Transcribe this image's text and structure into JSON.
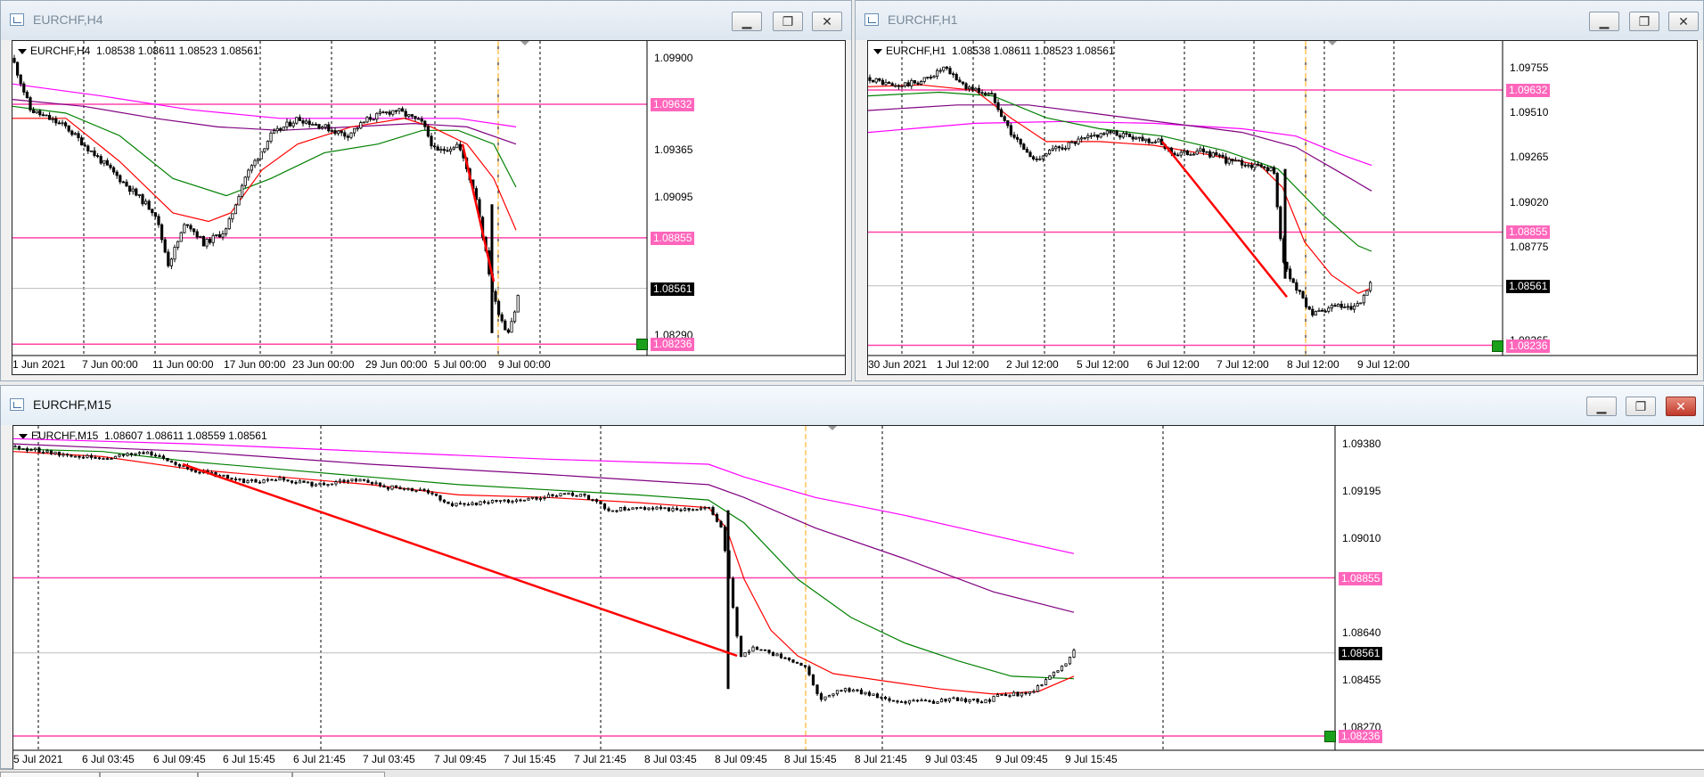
{
  "windows": [
    {
      "title": "EURCHF,H4",
      "info": "EURCHF,H4  1.08538 1.08611 1.08523 1.08561",
      "buttons": {
        "min": "▁",
        "max": "❐",
        "close": "✕"
      },
      "price_ticks": [
        "1.09900",
        "1.09365",
        "1.09095",
        "1.08290"
      ],
      "hline_labels": [
        "1.09632",
        "1.08855",
        "1.08236"
      ],
      "current_price": "1.08561",
      "time_labels": [
        "1 Jun 2021",
        "7 Jun 00:00",
        "11 Jun 00:00",
        "17 Jun 00:00",
        "23 Jun 00:00",
        "29 Jun 00:00",
        "5 Jul 00:00",
        "9 Jul 00:00"
      ]
    },
    {
      "title": "EURCHF,H1",
      "info": "EURCHF,H1  1.08538 1.08611 1.08523 1.08561",
      "buttons": {
        "min": "▁",
        "max": "❐",
        "close": "✕"
      },
      "price_ticks": [
        "1.09755",
        "1.09510",
        "1.09265",
        "1.09020",
        "1.08775",
        "1.08265"
      ],
      "hline_labels": [
        "1.09632",
        "1.08855",
        "1.08236"
      ],
      "current_price": "1.08561",
      "time_labels": [
        "30 Jun 2021",
        "1 Jul 12:00",
        "2 Jul 12:00",
        "5 Jul 12:00",
        "6 Jul 12:00",
        "7 Jul 12:00",
        "8 Jul 12:00",
        "9 Jul 12:00"
      ]
    },
    {
      "title": "EURCHF,M15",
      "info": "EURCHF,M15  1.08607 1.08611 1.08559 1.08561",
      "buttons": {
        "min": "▁",
        "max": "❐",
        "close": "✕"
      },
      "price_ticks": [
        "1.09380",
        "1.09195",
        "1.09010",
        "1.08640",
        "1.08455",
        "1.08270"
      ],
      "hline_labels": [
        "1.08855",
        "1.08236"
      ],
      "current_price": "1.08561",
      "time_labels": [
        "5 Jul 2021",
        "6 Jul 03:45",
        "6 Jul 09:45",
        "6 Jul 15:45",
        "6 Jul 21:45",
        "7 Jul 03:45",
        "7 Jul 09:45",
        "7 Jul 15:45",
        "7 Jul 21:45",
        "8 Jul 03:45",
        "8 Jul 09:45",
        "8 Jul 15:45",
        "8 Jul 21:45",
        "9 Jul 03:45",
        "9 Jul 09:45",
        "9 Jul 15:45"
      ]
    }
  ],
  "colors": {
    "hline": "#ff44aa",
    "hline_label_bg": "#ff66bb",
    "ema_red": "#ff0000",
    "ema_green": "#008000",
    "ma_purple": "#800080",
    "ma_magenta": "#ff00ff",
    "vline_orange": "#ffa500",
    "current_bg": "#000000"
  }
}
